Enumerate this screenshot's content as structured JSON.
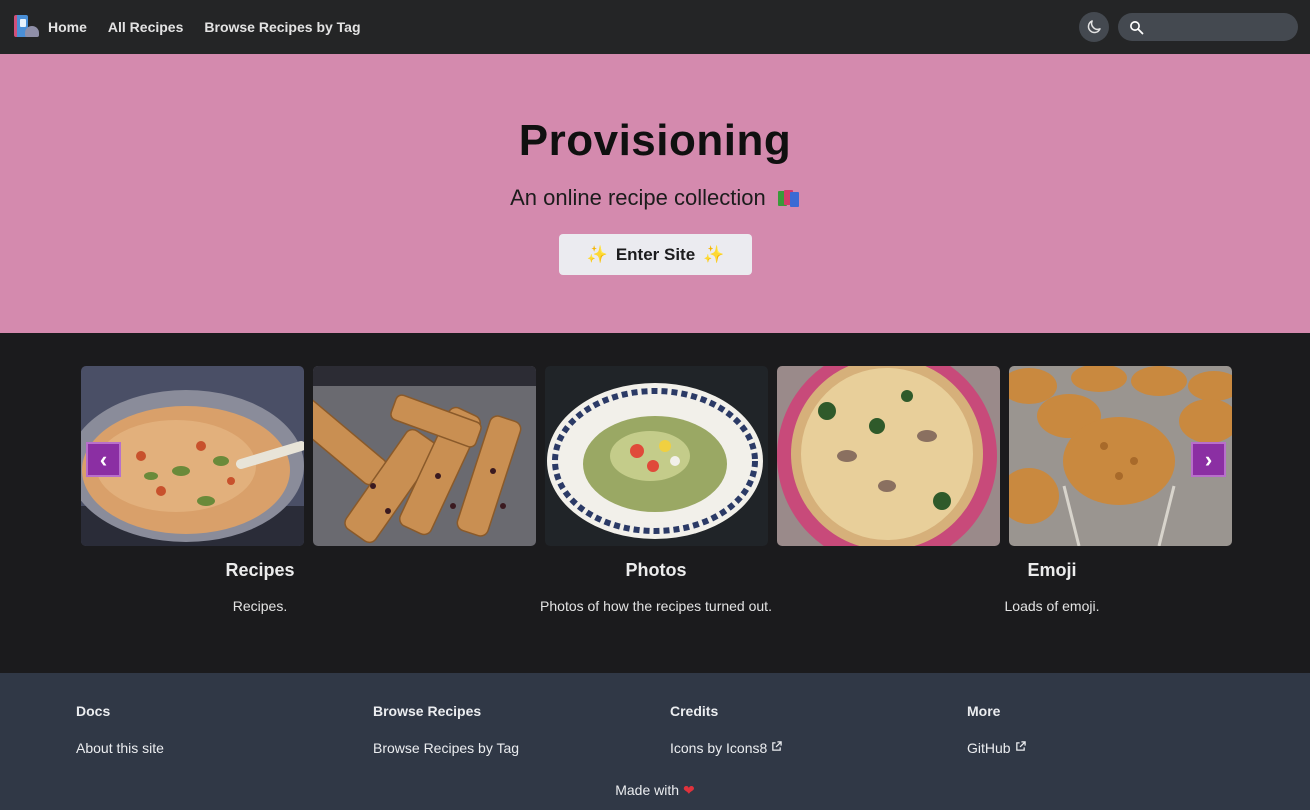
{
  "navbar": {
    "links": [
      "Home",
      "All Recipes",
      "Browse Recipes by Tag"
    ],
    "search_placeholder": ""
  },
  "hero": {
    "title": "Provisioning",
    "subtitle": "An online recipe collection",
    "button_label": "Enter Site",
    "background": "#d48aae"
  },
  "carousel": {
    "slides": [
      "soup-photo",
      "biscotti-photo",
      "pasta-photo",
      "quiche-photo",
      "muffins-photo"
    ],
    "prev_label": "‹",
    "next_label": "›",
    "arrow_color": "#8b2fa3"
  },
  "features": [
    {
      "title": "Recipes",
      "description": "Recipes."
    },
    {
      "title": "Photos",
      "description": "Photos of how the recipes turned out."
    },
    {
      "title": "Emoji",
      "description": "Loads of emoji."
    }
  ],
  "footer": {
    "columns": [
      {
        "title": "Docs",
        "link": "About this site"
      },
      {
        "title": "Browse Recipes",
        "link": "Browse Recipes by Tag"
      },
      {
        "title": "Credits",
        "link": "Icons by Icons8"
      },
      {
        "title": "More",
        "link": "GitHub"
      }
    ],
    "made_with": "Made with"
  }
}
